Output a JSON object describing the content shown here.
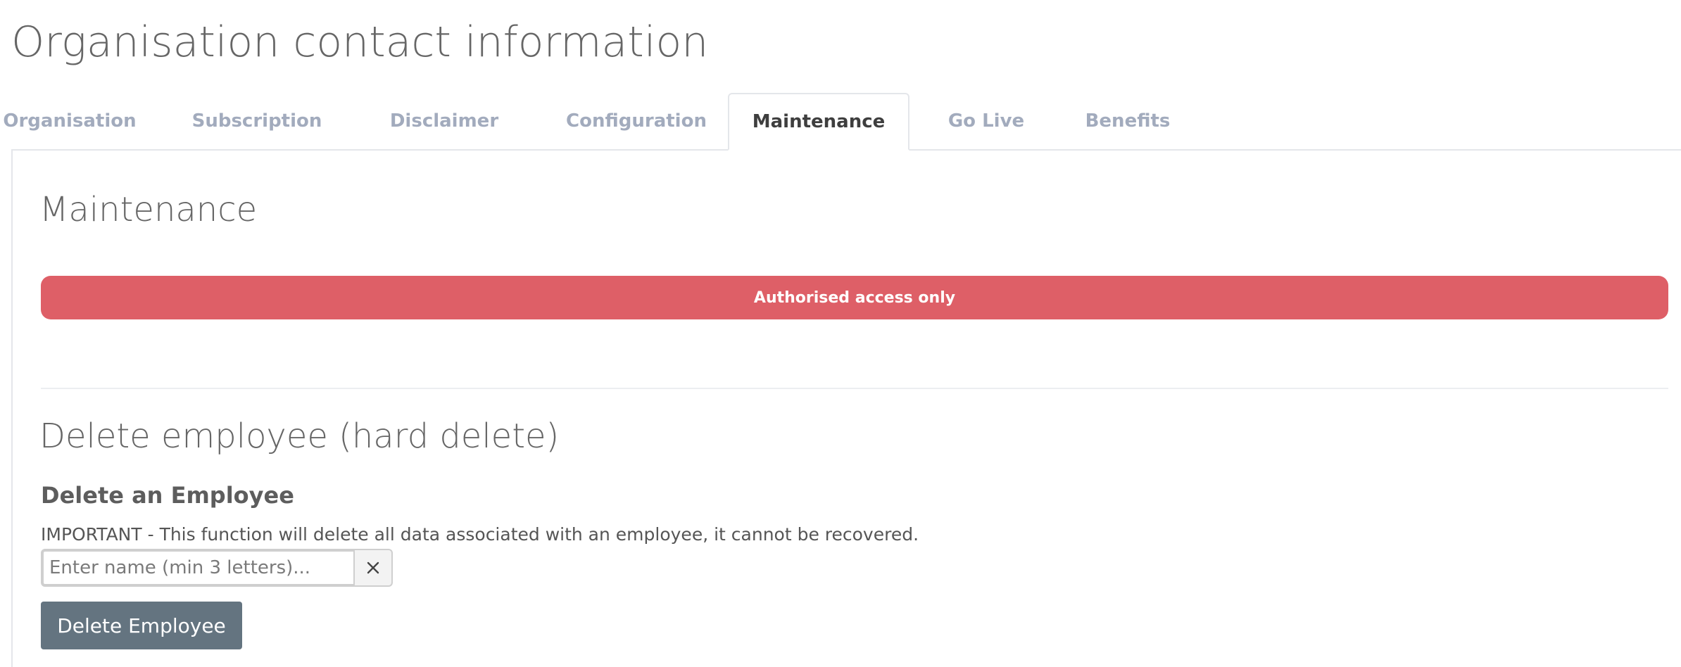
{
  "page": {
    "title": "Organisation contact information"
  },
  "tabs": [
    {
      "label": "Organisation",
      "active": false
    },
    {
      "label": "Subscription",
      "active": false
    },
    {
      "label": "Disclaimer",
      "active": false
    },
    {
      "label": "Configuration",
      "active": false
    },
    {
      "label": "Maintenance",
      "active": true
    },
    {
      "label": "Go Live",
      "active": false
    },
    {
      "label": "Benefits",
      "active": false
    }
  ],
  "maintenance": {
    "heading": "Maintenance",
    "alert_text": "Authorised access only",
    "alert_color": "#de5f67"
  },
  "delete_section": {
    "heading": "Delete employee (hard delete)",
    "subheading": "Delete an Employee",
    "warning": "IMPORTANT - This function will delete all data associated with an employee, it cannot be recovered.",
    "search": {
      "value": "",
      "placeholder": "Enter name (min 3 letters)..."
    },
    "clear_icon": "close-icon",
    "delete_button_label": "Delete Employee",
    "delete_button_color": "#647480"
  }
}
